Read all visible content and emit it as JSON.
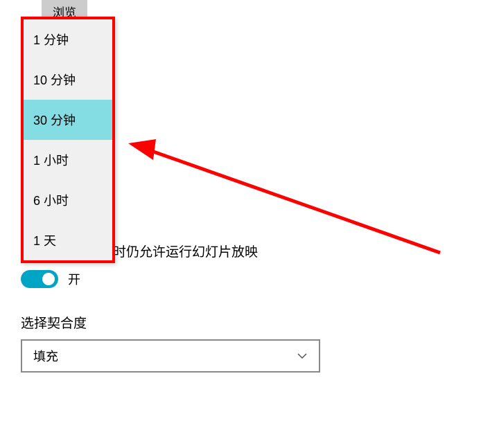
{
  "browse_button": "浏览",
  "dropdown": {
    "items": [
      "1 分钟",
      "10 分钟",
      "30 分钟",
      "1 小时",
      "6 小时",
      "1 天"
    ],
    "selected_index": 2
  },
  "battery_slideshow_text": "在使用电池供电时仍允许运行幻灯片放映",
  "toggle": {
    "state": "on",
    "label": "开"
  },
  "fit_label": "选择契合度",
  "fit_select": {
    "value": "填充"
  },
  "colors": {
    "highlight_red": "#ff0000",
    "selected_bg": "#85dde4",
    "toggle_on": "#00a4c4"
  }
}
